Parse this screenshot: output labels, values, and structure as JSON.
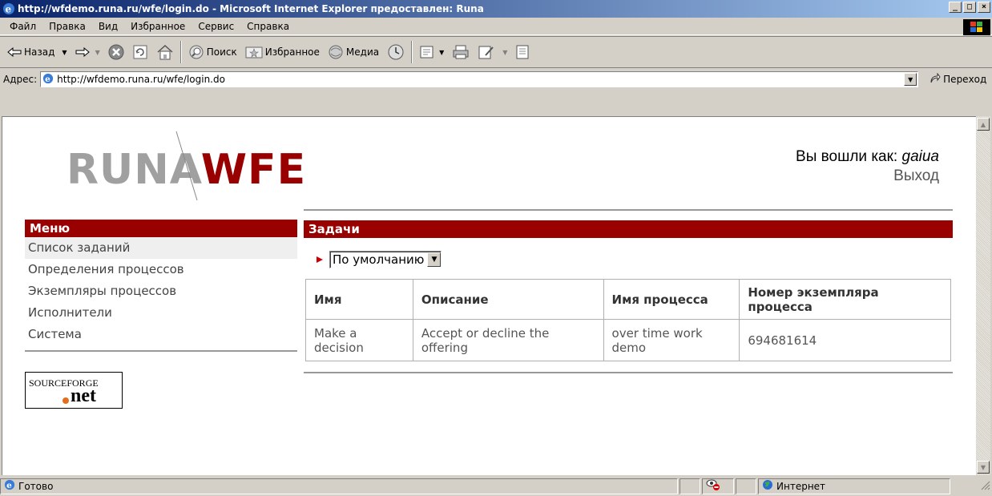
{
  "window": {
    "title": "http://wfdemo.runa.ru/wfe/login.do - Microsoft Internet Explorer предоставлен: Runa",
    "minimize_label": "_",
    "maximize_label": "□",
    "close_label": "×"
  },
  "menubar": {
    "items": [
      "Файл",
      "Правка",
      "Вид",
      "Избранное",
      "Сервис",
      "Справка"
    ]
  },
  "toolbar": {
    "back_label": "Назад",
    "search_label": "Поиск",
    "favorites_label": "Избранное",
    "media_label": "Медиа"
  },
  "address": {
    "label": "Адрес:",
    "url": "http://wfdemo.runa.ru/wfe/login.do",
    "go_label": "Переход"
  },
  "status": {
    "text": "Готово",
    "zone": "Интернет"
  },
  "page": {
    "logo_left": "RUNA",
    "logo_right": "WFE",
    "logged_in_label": "Вы вошли как:",
    "username": "gaiua",
    "logout_label": "Выход",
    "menu_title": "Меню",
    "menu_items": [
      "Список заданий",
      "Определения процессов",
      "Экземпляры процессов",
      "Исполнители",
      "Система"
    ],
    "sourceforge_top": "SOURCEFORGE",
    "sourceforge_bottom": "net",
    "tasks_title": "Задачи",
    "filter_value": "По умолчанию",
    "table": {
      "headers": [
        "Имя",
        "Описание",
        "Имя процесса",
        "Номер экземпляра процесса"
      ],
      "rows": [
        [
          "Make a decision",
          "Accept or decline the offering",
          "over time work demo",
          "694681614"
        ]
      ]
    }
  }
}
